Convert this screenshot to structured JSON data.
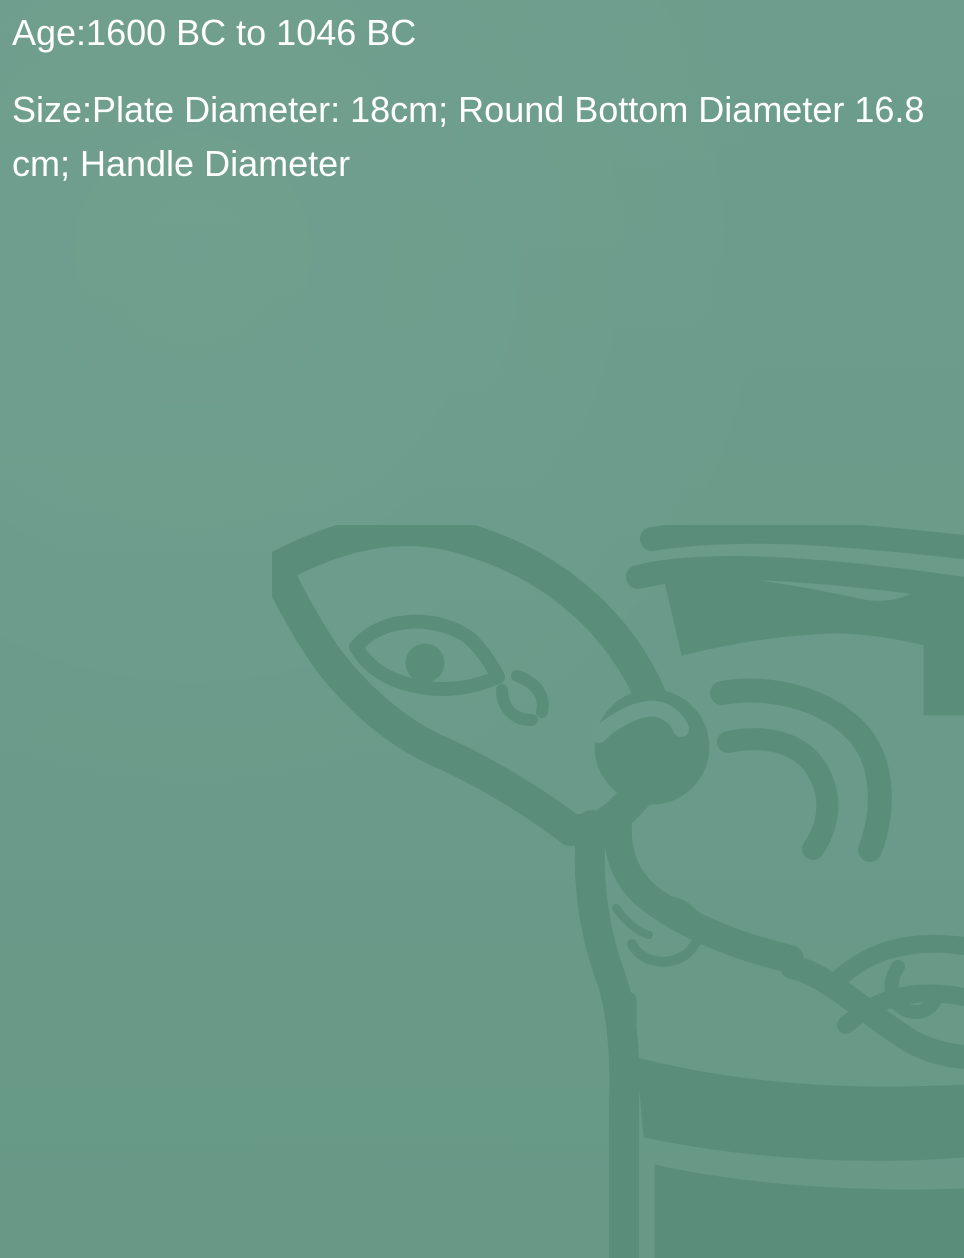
{
  "details": {
    "age": "Age:1600 BC to 1046 BC",
    "size": "Size:Plate Diameter: 18cm; Round Bottom Diameter 16.8cm; Handle Diameter"
  },
  "decoration": {
    "icon": "bronze-mask-motif",
    "color": "#5a8e7b"
  },
  "colors": {
    "background": "#6b9c8b",
    "text": "#ffffff",
    "motif": "#5a8e7b"
  }
}
